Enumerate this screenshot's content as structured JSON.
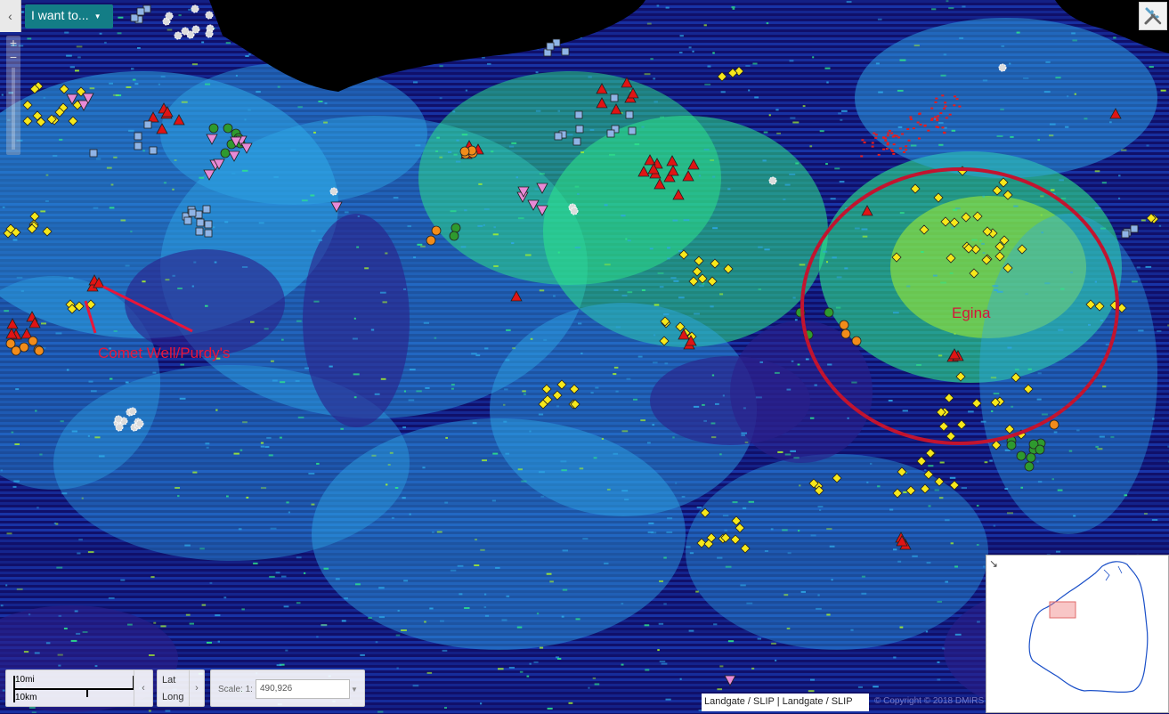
{
  "toolbar": {
    "collapse_icon": "chevron-left-icon",
    "i_want_label": "I want to...",
    "i_want_caret": "caret-down-icon",
    "zoom_in": "+",
    "zoom_out": "−",
    "toolbox_icon": "tools-icon"
  },
  "map": {
    "annotations": [
      {
        "text": "Comet Well/Purdy's",
        "color": "#e8163a"
      },
      {
        "text": "Egina",
        "color": "#d4163a"
      }
    ],
    "highlight_circle_color": "#c2142f",
    "palette": {
      "background": "#10106a",
      "shoreline": "#000000",
      "vegetation_low": "#1f4fd6",
      "vegetation_mid": "#2ea8e6",
      "vegetation_high": "#2ee88a",
      "vegetation_peak": "#a6f22e",
      "hotspot": "#e81c1c"
    },
    "marker_styles": [
      {
        "shape": "diamond",
        "fill": "#f7e81a"
      },
      {
        "shape": "triangle",
        "fill": "#e01414"
      },
      {
        "shape": "circle",
        "fill": "#2e9a2e"
      },
      {
        "shape": "circle",
        "fill": "#f28c1a"
      },
      {
        "shape": "square",
        "fill": "#8fb4e6"
      },
      {
        "shape": "triangle-down",
        "fill": "#e88ad6"
      },
      {
        "shape": "star",
        "fill": "#dcdcdc"
      }
    ]
  },
  "scale_bar": {
    "imperial_label": "10mi",
    "metric_label": "10km",
    "toggle_icon": "chevron-left-icon"
  },
  "coordinates": {
    "lat_label": "Lat",
    "long_label": "Long",
    "toggle_icon": "chevron-right-icon"
  },
  "scale_input": {
    "label": "Scale: 1:",
    "value": "490,926",
    "dropdown_icon": "caret-down-icon"
  },
  "attribution": {
    "text": "Landgate / SLIP | Landgate / SLIP",
    "copyright": "© Copyright © 2018 DMIRS"
  },
  "overview": {
    "expand_icon": "arrow-diagonal-icon",
    "coast_color": "#1a4fc8",
    "extent_color": "#f08080"
  }
}
